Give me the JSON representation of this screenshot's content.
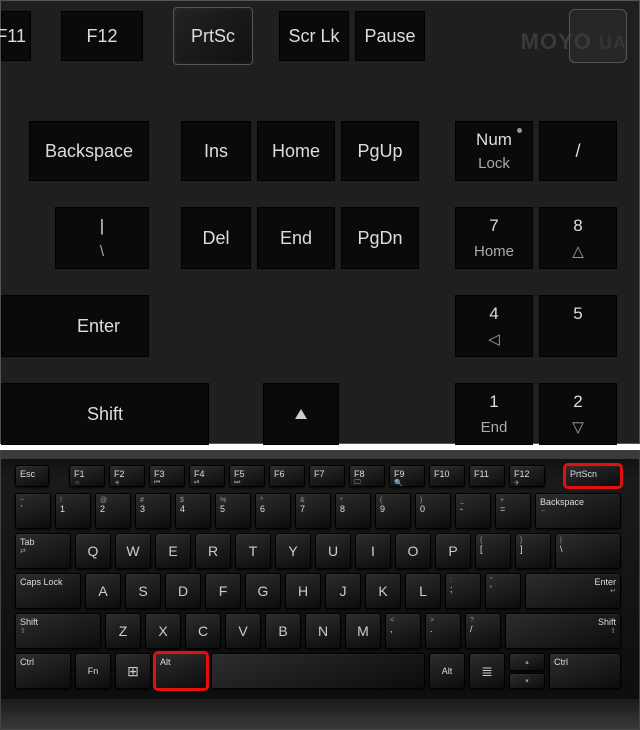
{
  "top": {
    "watermark": "MOYO",
    "watermark_sub": "UA",
    "row1": {
      "f11": "F11",
      "f12": "F12",
      "prtsc": "PrtSc",
      "scrlk": "Scr Lk",
      "pause": "Pause"
    },
    "row2": {
      "backspace": "Backspace",
      "ins": "Ins",
      "home": "Home",
      "pgup": "PgUp",
      "numlock_top": "Num",
      "numlock_bot": "Lock",
      "slash": "/"
    },
    "row3": {
      "pipe_top": "|",
      "pipe_bot": "\\",
      "del": "Del",
      "end": "End",
      "pgdn": "PgDn",
      "k7_top": "7",
      "k7_bot": "Home",
      "k8_top": "8",
      "k8_bot": "△"
    },
    "row4": {
      "enter": "Enter",
      "k4_top": "4",
      "k4_bot": "◁",
      "k5_top": "5",
      "k5_bot": ""
    },
    "row5": {
      "shift": "Shift",
      "k1_top": "1",
      "k1_bot": "End",
      "k2_top": "2",
      "k2_bot": "▽"
    }
  },
  "bottom": {
    "fnrow": [
      "Esc",
      "F1",
      "F2",
      "F3",
      "F4",
      "F5",
      "F6",
      "F7",
      "F8",
      "F9",
      "F10",
      "F11",
      "F12",
      "PrtScn"
    ],
    "numrow_top": [
      "~",
      "!",
      "@",
      "#",
      "$",
      "%",
      "^",
      "&",
      "*",
      "(",
      ")",
      "_",
      "+"
    ],
    "numrow_bot": [
      "`",
      "1",
      "2",
      "3",
      "4",
      "5",
      "6",
      "7",
      "8",
      "9",
      "0",
      "-",
      "="
    ],
    "backspace": "Backspace",
    "tab": "Tab",
    "qrow": [
      "Q",
      "W",
      "E",
      "R",
      "T",
      "Y",
      "U",
      "I",
      "O",
      "P"
    ],
    "brack_top": [
      "{",
      "}",
      "|"
    ],
    "brack_bot": [
      "[",
      "]",
      "\\"
    ],
    "caps": "Caps Lock",
    "arow": [
      "A",
      "S",
      "D",
      "F",
      "G",
      "H",
      "J",
      "K",
      "L"
    ],
    "semi_top": [
      ":",
      "\""
    ],
    "semi_bot": [
      ";",
      "'"
    ],
    "enter": "Enter",
    "shift": "Shift",
    "zrow": [
      "Z",
      "X",
      "C",
      "V",
      "B",
      "N",
      "M"
    ],
    "punct_top": [
      "<",
      ">",
      "?"
    ],
    "punct_bot": [
      ",",
      ".",
      "/"
    ],
    "rshift": "Shift",
    "ctrl": "Ctrl",
    "fn": "Fn",
    "win": "",
    "alt": "Alt",
    "rctrl": "Ctrl"
  },
  "highlights": {
    "top_key": "prtsc",
    "bottom_keys": [
      "alt",
      "prtscn"
    ]
  },
  "colors": {
    "green": "#1fdd1f",
    "red": "#e40f0f",
    "bg": "#1f1f1f"
  }
}
